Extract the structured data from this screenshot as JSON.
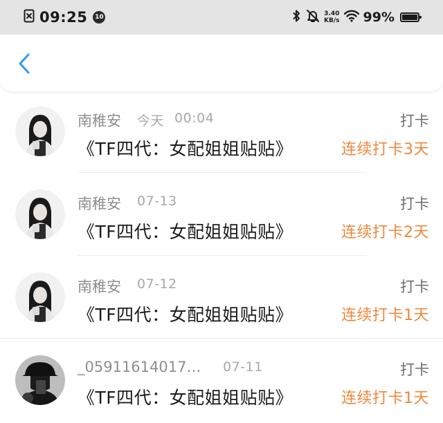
{
  "status_bar": {
    "time": "09:25",
    "badge": "10",
    "speed_value": "3.40",
    "speed_unit": "KB/s",
    "battery_percent": "99%",
    "icons": [
      "notification-x-icon",
      "bluetooth-icon",
      "bell-off-icon",
      "wifi-icon",
      "battery-icon"
    ]
  },
  "nav": {
    "back_icon": "chevron-left-icon",
    "accent_color": "#2f9bf0"
  },
  "checkins": [
    {
      "user": "南稚安",
      "date": "今天",
      "time": "00:04",
      "action": "打卡",
      "title": "《TF四代：女配姐姐贴贴》",
      "streak": "连续打卡3天",
      "avatar": "avatar-girl"
    },
    {
      "user": "南稚安",
      "date": "07-13",
      "time": "",
      "action": "打卡",
      "title": "《TF四代：女配姐姐贴贴》",
      "streak": "连续打卡2天",
      "avatar": "avatar-girl"
    },
    {
      "user": "南稚安",
      "date": "07-12",
      "time": "",
      "action": "打卡",
      "title": "《TF四代：女配姐姐贴贴》",
      "streak": "连续打卡1天",
      "avatar": "avatar-girl"
    },
    {
      "user": "_05911614017…",
      "date": "07-11",
      "time": "",
      "action": "打卡",
      "title": "《TF四代：女配姐姐贴贴》",
      "streak": "连续打卡1天",
      "avatar": "avatar-hat"
    }
  ],
  "colors": {
    "streak": "#f0873a",
    "status_bar_bg": "#e4e4e4"
  }
}
